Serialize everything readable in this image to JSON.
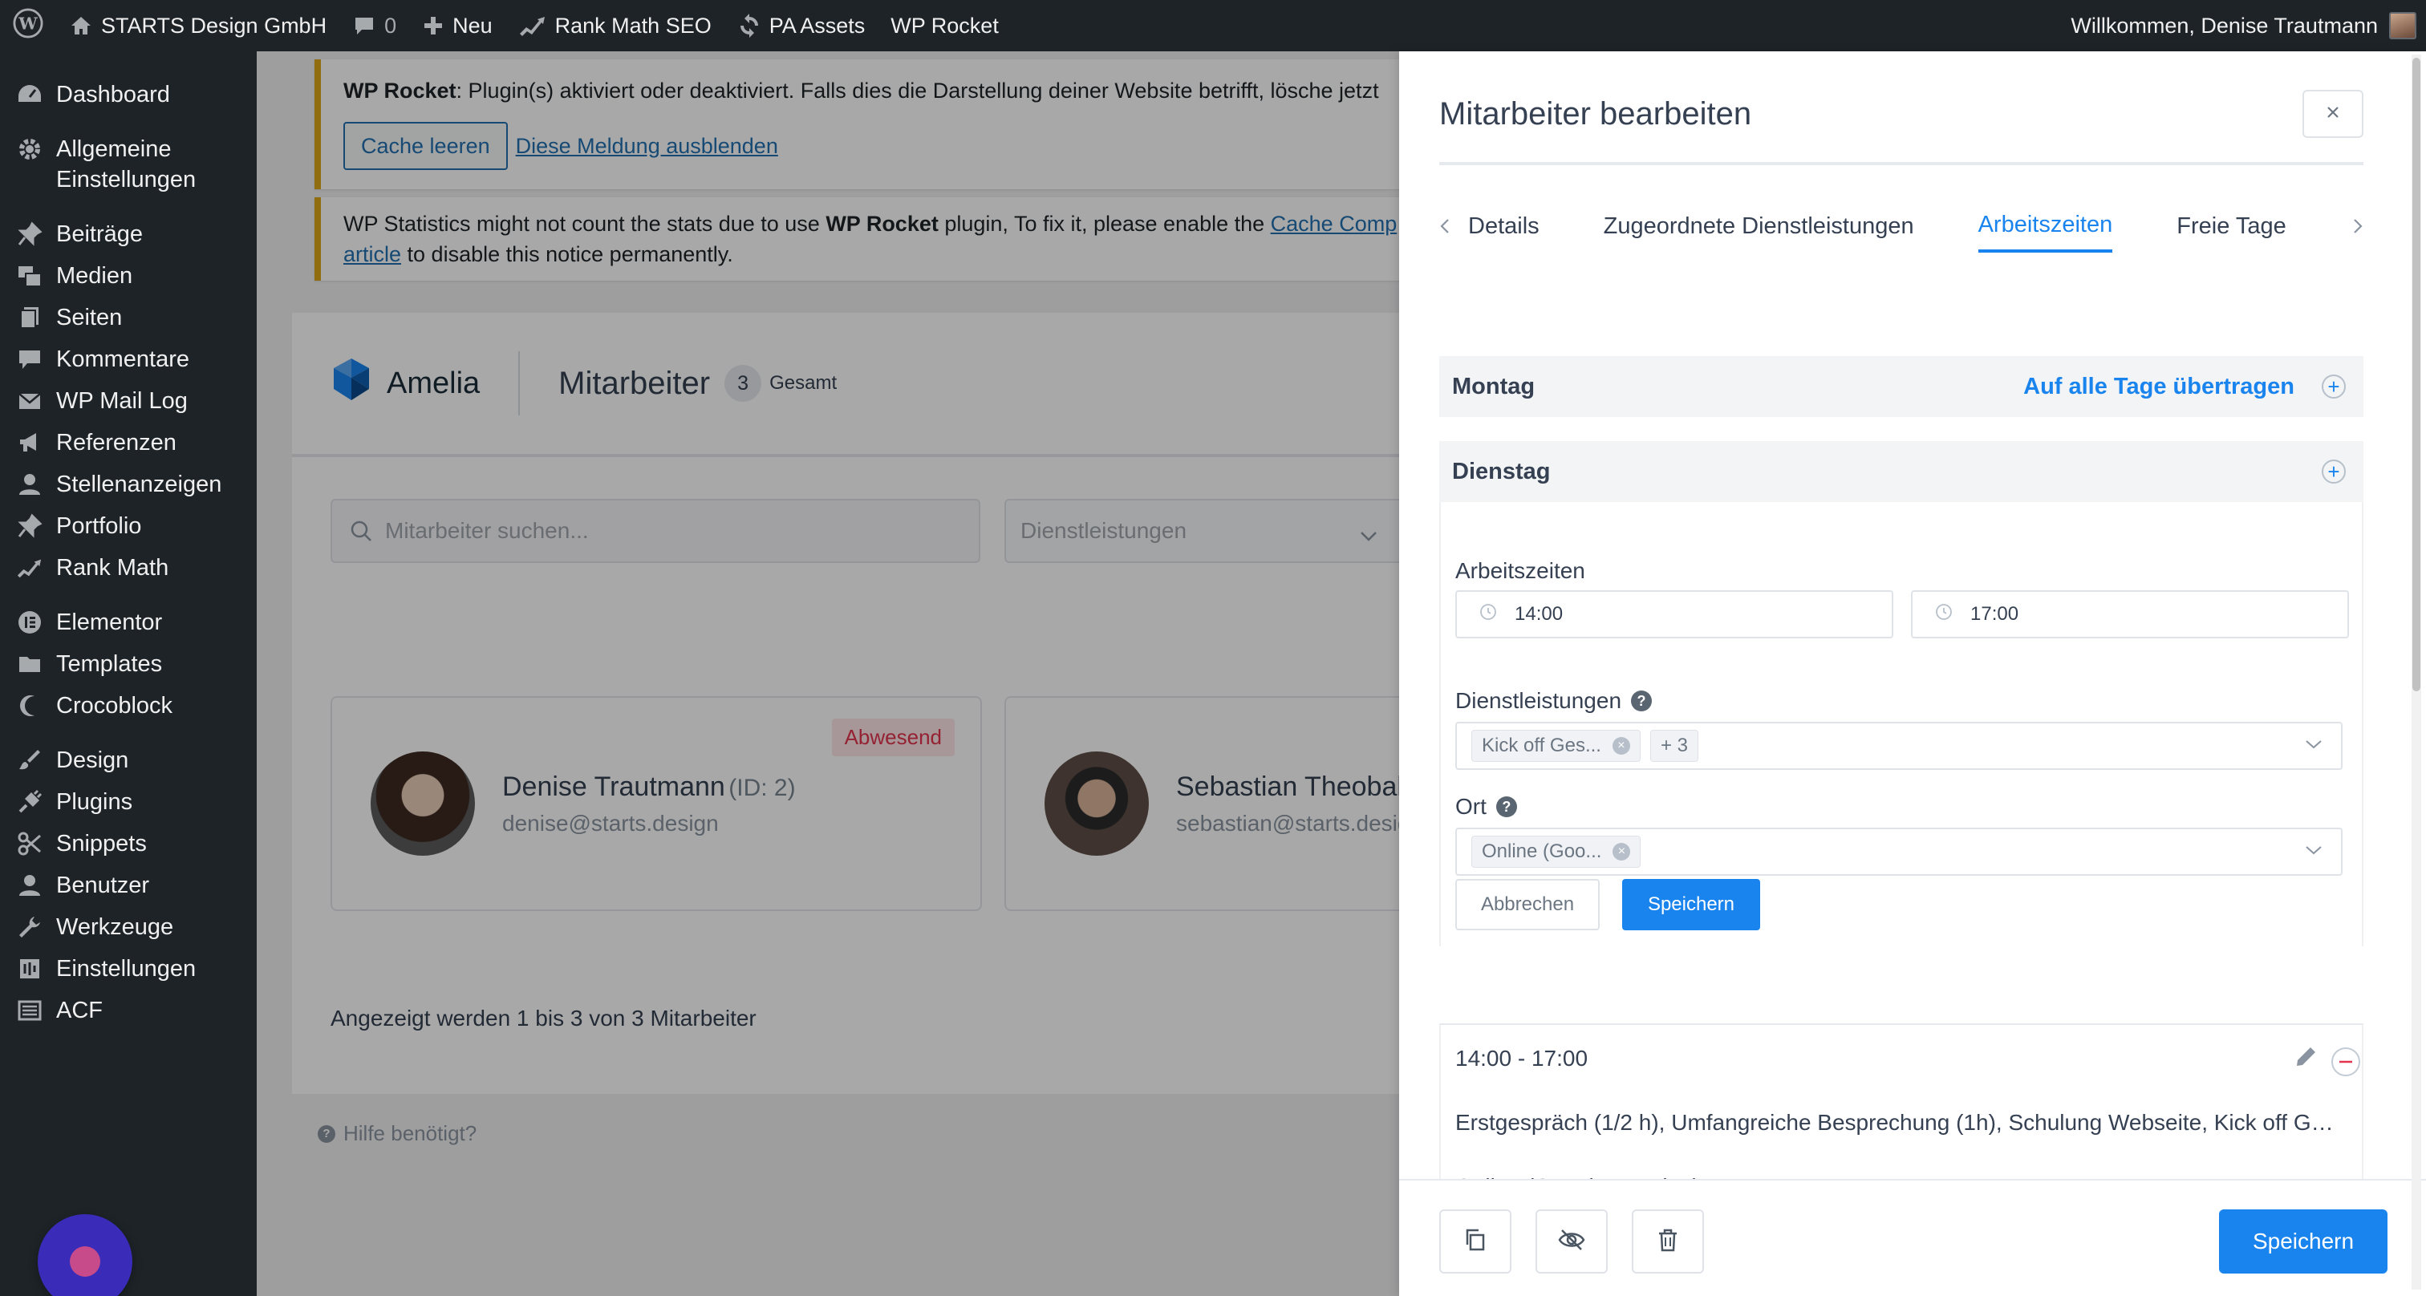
{
  "adminbar": {
    "site_name": "STARTS Design GmbH",
    "comments_count": "0",
    "new_label": "Neu",
    "rankmath_label": "Rank Math SEO",
    "pa_assets_label": "PA Assets",
    "wprocket_label": "WP Rocket",
    "greeting": "Willkommen, Denise Trautmann"
  },
  "sidebar": {
    "items": [
      {
        "label": "Dashboard",
        "icon": "dashboard-icon"
      },
      {
        "label": "Allgemeine Einstellungen",
        "icon": "gear-icon"
      },
      {
        "label": "Beiträge",
        "icon": "pin-icon"
      },
      {
        "label": "Medien",
        "icon": "media-icon"
      },
      {
        "label": "Seiten",
        "icon": "pages-icon"
      },
      {
        "label": "Kommentare",
        "icon": "comment-icon"
      },
      {
        "label": "WP Mail Log",
        "icon": "mail-icon"
      },
      {
        "label": "Referenzen",
        "icon": "megaphone-icon"
      },
      {
        "label": "Stellenanzeigen",
        "icon": "user-icon"
      },
      {
        "label": "Portfolio",
        "icon": "pin-icon"
      },
      {
        "label": "Rank Math",
        "icon": "rankmath-icon"
      },
      {
        "label": "Elementor",
        "icon": "elementor-icon"
      },
      {
        "label": "Templates",
        "icon": "folder-icon"
      },
      {
        "label": "Crocoblock",
        "icon": "crocoblock-icon"
      },
      {
        "label": "Design",
        "icon": "brush-icon"
      },
      {
        "label": "Plugins",
        "icon": "plugin-icon"
      },
      {
        "label": "Snippets",
        "icon": "scissors-icon"
      },
      {
        "label": "Benutzer",
        "icon": "user-icon"
      },
      {
        "label": "Werkzeuge",
        "icon": "wrench-icon"
      },
      {
        "label": "Einstellungen",
        "icon": "settings-icon"
      },
      {
        "label": "ACF",
        "icon": "acf-icon"
      }
    ]
  },
  "notices": {
    "wprocket_bold": "WP Rocket",
    "wprocket_text": ": Plugin(s) aktiviert oder deaktiviert. Falls dies die Darstellung deiner Website betrifft, lösche jetzt",
    "cache_button": "Cache leeren",
    "dismiss_link": "Diese Meldung ausblenden",
    "stats_text_1": "WP Statistics might not count the stats due to use ",
    "stats_bold": "WP Rocket",
    "stats_text_2": " plugin, To fix it, please enable the ",
    "stats_link": "Cache Comp",
    "stats_link_2": "article",
    "stats_text_3": " to disable this notice permanently."
  },
  "amelia": {
    "brand": "Amelia",
    "page_title": "Mitarbeiter",
    "total_count": "3",
    "total_label": "Gesamt",
    "search_placeholder": "Mitarbeiter suchen...",
    "services_placeholder": "Dienstleistungen",
    "employees": [
      {
        "name": "Denise Trautmann",
        "id_label": "(ID: 2)",
        "email": "denise@starts.design",
        "status": "Abwesend"
      },
      {
        "name": "Sebastian Theobald",
        "id_label": "",
        "email": "sebastian@starts.desig",
        "status": ""
      }
    ],
    "paging": "Angezeigt werden 1 bis 3 von 3 Mitarbeiter",
    "help": "Hilfe benötigt?"
  },
  "drawer": {
    "title": "Mitarbeiter bearbeiten",
    "tabs": [
      {
        "label": "Details",
        "active": false
      },
      {
        "label": "Zugeordnete Dienstleistungen",
        "active": false
      },
      {
        "label": "Arbeitszeiten",
        "active": true
      },
      {
        "label": "Freie Tage",
        "active": false
      }
    ],
    "days": {
      "monday": "Montag",
      "transfer_all": "Auf alle Tage übertragen",
      "tuesday": "Dienstag"
    },
    "edit": {
      "worktime_label": "Arbeitszeiten",
      "start_time": "14:00",
      "end_time": "17:00",
      "services_label": "Dienstleistungen",
      "services_chip": "Kick off Ges...",
      "services_more": "+ 3",
      "location_label": "Ort",
      "location_chip": "Online (Goo...",
      "cancel": "Abbrechen",
      "save": "Speichern"
    },
    "period": {
      "time": "14:00 - 17:00",
      "services": "Erstgespräch (1/2 h), Umfangreiche Besprechung (1h), Schulung Webseite, Kick off Gespräch",
      "location": "Online (Google Meeting)"
    },
    "footer_save": "Speichern"
  },
  "colors": {
    "accent": "#1a84ee",
    "admin_dark": "#1d2327",
    "absent": "#e2344c"
  }
}
